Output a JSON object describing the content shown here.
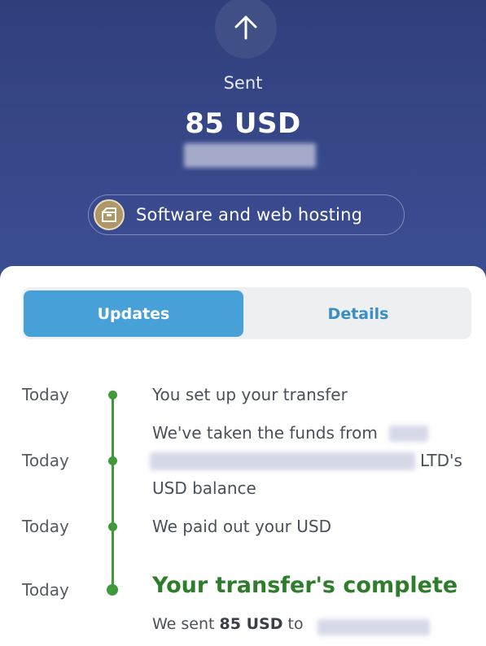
{
  "header": {
    "status_label": "Sent",
    "amount": "85 USD",
    "category_label": "Software and web hosting"
  },
  "tabs": [
    {
      "label": "Updates",
      "active": true
    },
    {
      "label": "Details",
      "active": false
    }
  ],
  "timeline": [
    {
      "day": "Today",
      "text_1": "You set up your transfer"
    },
    {
      "day": "Today",
      "text_1": "We've taken the funds from",
      "text_2": "LTD's",
      "text_3": "USD balance"
    },
    {
      "day": "Today",
      "text_1": "We paid out your USD"
    },
    {
      "day": "Today",
      "text_1": "Your transfer's complete",
      "sent_prefix": "We sent",
      "sent_amount": "85 USD",
      "sent_suffix": "to"
    }
  ],
  "colors": {
    "header_bg": "#37488a",
    "tab_active": "#48a0d8",
    "timeline_green": "#3f9a3c",
    "complete_green": "#2d7d2b"
  },
  "icons": {
    "top": "arrow-up-icon",
    "category": "package-icon"
  }
}
